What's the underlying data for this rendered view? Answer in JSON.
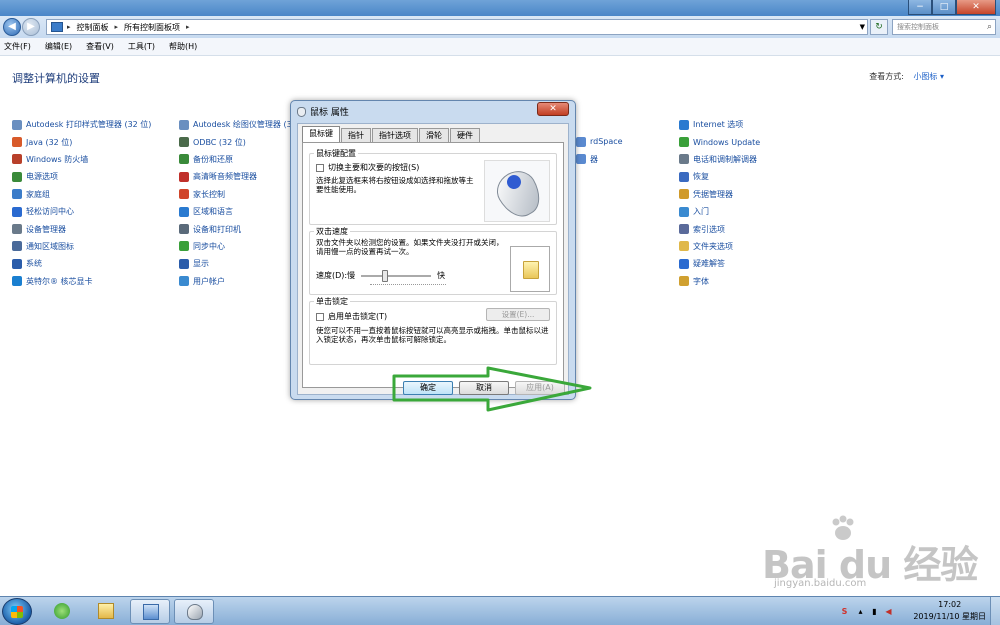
{
  "window": {
    "min": "−",
    "max": "□",
    "close": "✕"
  },
  "address": {
    "crumbs": [
      "控制面板",
      "所有控制面板项"
    ],
    "search_placeholder": "搜索控制面板"
  },
  "menubar": [
    "文件(F)",
    "编辑(E)",
    "查看(V)",
    "工具(T)",
    "帮助(H)"
  ],
  "heading": "调整计算机的设置",
  "view_by": {
    "label": "查看方式:",
    "value": "小图标 ▾"
  },
  "columns": [
    {
      "items": [
        {
          "label": "Autodesk 打印样式管理器 (32 位)",
          "color": "#6a8fc0"
        },
        {
          "label": "Java (32 位)",
          "color": "#d85a2a"
        },
        {
          "label": "Windows 防火墙",
          "color": "#b8402a"
        },
        {
          "label": "电源选项",
          "color": "#3a8a3a"
        },
        {
          "label": "家庭组",
          "color": "#3b7cc9"
        },
        {
          "label": "轻松访问中心",
          "color": "#2a6ad0"
        },
        {
          "label": "设备管理器",
          "color": "#6a7a8a"
        },
        {
          "label": "通知区域图标",
          "color": "#4a6a9a"
        },
        {
          "label": "系统",
          "color": "#2a5caa"
        },
        {
          "label": "英特尔® 核芯显卡",
          "color": "#1a7fd0"
        }
      ]
    },
    {
      "items": [
        {
          "label": "Autodesk 绘图仪管理器 (32 位)",
          "color": "#6a8fc0"
        },
        {
          "label": "ODBC (32 位)",
          "color": "#4a6a4a"
        },
        {
          "label": "备份和还原",
          "color": "#3a8a3a"
        },
        {
          "label": "高清晰音频管理器",
          "color": "#c0302a"
        },
        {
          "label": "家长控制",
          "color": "#d0452a"
        },
        {
          "label": "区域和语言",
          "color": "#2a7ad0"
        },
        {
          "label": "设备和打印机",
          "color": "#5a6a7a"
        },
        {
          "label": "同步中心",
          "color": "#3aa03a"
        },
        {
          "label": "显示",
          "color": "#2a5caa"
        },
        {
          "label": "用户帐户",
          "color": "#3a8ad0"
        }
      ]
    },
    {
      "items": [
        {
          "label": "rdSpace",
          "color": "#5a8ad0"
        },
        {
          "label": "器",
          "color": "#5a8ad0"
        }
      ]
    },
    {
      "items": [
        {
          "label": "Internet 选项",
          "color": "#2a7ad0"
        },
        {
          "label": "Windows Update",
          "color": "#3aa03a"
        },
        {
          "label": "电话和调制解调器",
          "color": "#6a7a8a"
        },
        {
          "label": "恢复",
          "color": "#3a6ac0"
        },
        {
          "label": "凭据管理器",
          "color": "#d09a2a"
        },
        {
          "label": "入门",
          "color": "#3a8ad0"
        },
        {
          "label": "索引选项",
          "color": "#5a6a9a"
        },
        {
          "label": "文件夹选项",
          "color": "#e0b84a"
        },
        {
          "label": "疑难解答",
          "color": "#2a6ad0"
        },
        {
          "label": "字体",
          "color": "#d0a030"
        }
      ]
    }
  ],
  "dialog": {
    "title": "鼠标 属性",
    "close": "✕",
    "tabs": [
      "鼠标键",
      "指针",
      "指针选项",
      "滑轮",
      "硬件"
    ],
    "group1": {
      "title": "鼠标键配置",
      "checkbox": "切换主要和次要的按钮(S)",
      "desc": "选择此复选框来将右按钮设成如选择和拖放等主要性能使用。"
    },
    "group2": {
      "title": "双击速度",
      "desc": "双击文件夹以检测您的设置。如果文件夹没打开或关闭，请用慢一点的设置再试一次。",
      "speed_label": "速度(D):慢",
      "speed_fast": "快",
      "speed_level": 0.33
    },
    "group3": {
      "title": "单击锁定",
      "checkbox": "启用单击锁定(T)",
      "settings": "设置(E)...",
      "desc": "使您可以不用一直按着鼠标按钮就可以高亮显示或拖拽。单击鼠标以进入锁定状态，再次单击鼠标可解除锁定。"
    },
    "buttons": {
      "ok": "确定",
      "cancel": "取消",
      "apply": "应用(A)"
    }
  },
  "annotation_color": "#3aa83a",
  "taskbar": {
    "time": "17:02",
    "date": "2019/11/10 星期日"
  },
  "watermark": {
    "text": "Bai du 经验",
    "sub": "jingyan.baidu.com"
  }
}
